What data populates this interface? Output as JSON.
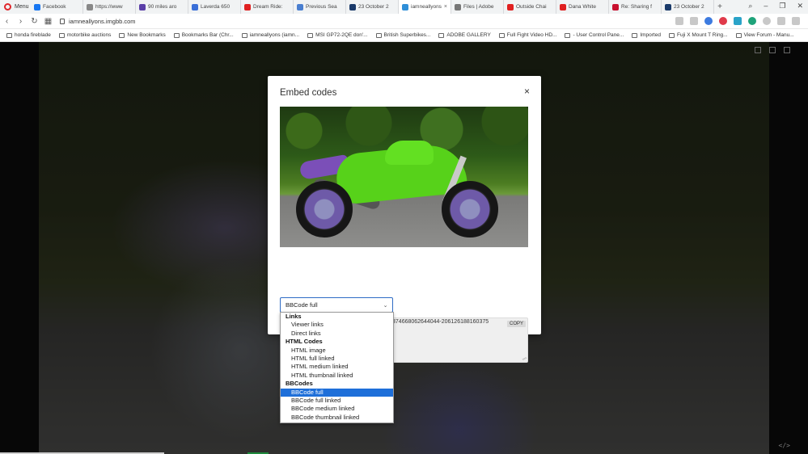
{
  "browser": {
    "menu_label": "Menu",
    "tabs": [
      {
        "label": "Facebook",
        "color": "#1877f2"
      },
      {
        "label": "https://www",
        "color": "#888888"
      },
      {
        "label": "90 miles aro",
        "color": "#5b3fa8"
      },
      {
        "label": "Laverda 650",
        "color": "#3a6fd8"
      },
      {
        "label": "Dream Ride:",
        "color": "#e02020"
      },
      {
        "label": "Previous Sea",
        "color": "#4a7fd0"
      },
      {
        "label": "23 October 2",
        "color": "#1a3a6a"
      },
      {
        "label": "iamneallyons",
        "color": "#2f8fd8",
        "active": true
      },
      {
        "label": "Files | Adobe",
        "color": "#777777"
      },
      {
        "label": "Outside Chai",
        "color": "#e02020"
      },
      {
        "label": "Dana White",
        "color": "#e02020"
      },
      {
        "label": "Re: Sharing f",
        "color": "#c8102e"
      },
      {
        "label": "23 October 2",
        "color": "#1a3a6a"
      }
    ],
    "new_tab_label": "+",
    "url": "iamneallyons.imgbb.com",
    "bookmarks": [
      "honda fireblade",
      "motorbike auctions",
      "New Bookmarks",
      "Bookmarks Bar (Chr...",
      "iamneallyons (iamn...",
      "MSI GP72-2QE don'...",
      "British Superbikes...",
      "ADOBE GALLERY",
      "Full Fight Video HD...",
      "- User Control Pane...",
      "Imported",
      "Fuji X Mount T Ring...",
      "View Forum - Manu..."
    ]
  },
  "modal": {
    "title": "Embed codes",
    "close_symbol": "×",
    "selected_code_type": "BBCode full",
    "code_text": "59-5374668062644044-2061261881603​75",
    "copy_label": "COPY"
  },
  "dropdown": {
    "groups": [
      {
        "label": "Links",
        "options": [
          "Viewer links",
          "Direct links"
        ]
      },
      {
        "label": "HTML Codes",
        "options": [
          "HTML image",
          "HTML full linked",
          "HTML medium linked",
          "HTML thumbnail linked"
        ]
      },
      {
        "label": "BBCodes",
        "options": [
          "BBCode full",
          "BBCode full linked",
          "BBCode medium linked",
          "BBCode thumbnail linked"
        ]
      }
    ],
    "selected": "BBCode full"
  },
  "colors": {
    "accent_blue": "#1e6fd9",
    "select_border": "#2f6cc5",
    "overlay": "#0b0b0b"
  }
}
